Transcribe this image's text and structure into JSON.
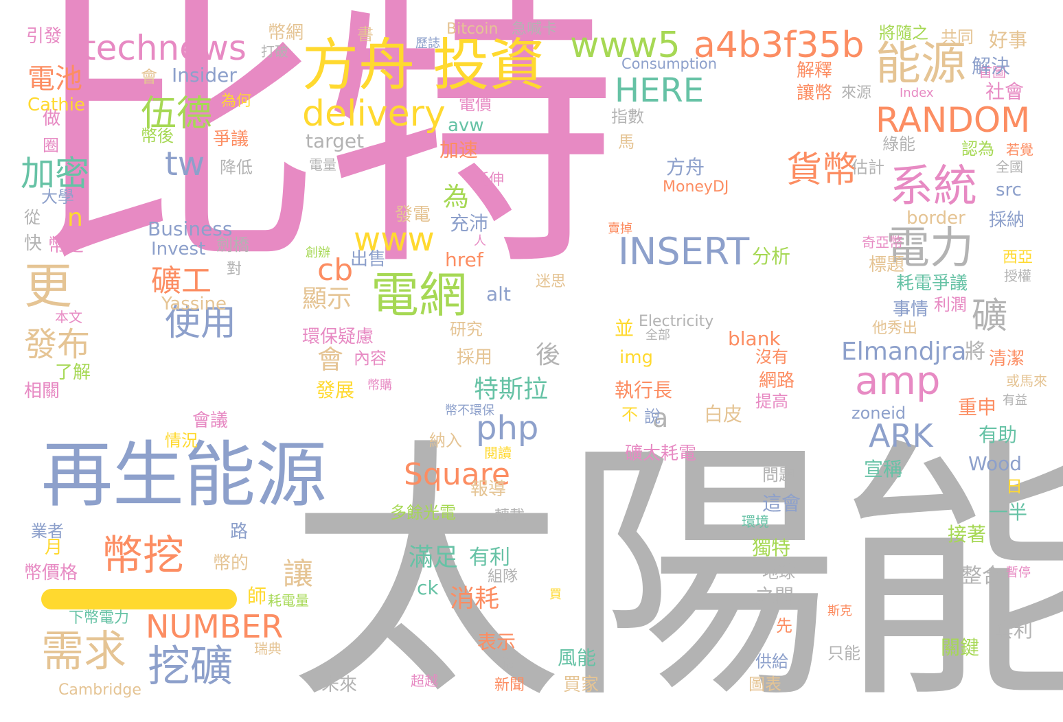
{
  "palette": {
    "pink": "#e78ac3",
    "gray": "#b3b3b3",
    "blue": "#8da0cb",
    "orange": "#fc8d62",
    "green": "#a6d854",
    "yellow": "#ffd92f",
    "teal": "#66c2a5",
    "tan": "#e5c494"
  },
  "words": [
    {
      "text": "比特",
      "color": "pink"
    },
    {
      "text": "太陽能",
      "color": "gray"
    },
    {
      "text": "再生能源",
      "color": "blue"
    },
    {
      "text": "方舟 投資",
      "color": "yellow"
    },
    {
      "text": "technews",
      "color": "pink"
    },
    {
      "text": "www5",
      "color": "green"
    },
    {
      "text": "a4b3f35b",
      "color": "orange"
    },
    {
      "text": "能源",
      "color": "tan"
    },
    {
      "text": "delivery",
      "color": "yellow"
    },
    {
      "text": "HERE",
      "color": "teal"
    },
    {
      "text": "RANDOM",
      "color": "orange"
    },
    {
      "text": "系統",
      "color": "pink"
    },
    {
      "text": "貨幣",
      "color": "orange"
    },
    {
      "text": "電力",
      "color": "gray"
    },
    {
      "text": "伍德",
      "color": "green"
    },
    {
      "text": "tw",
      "color": "blue"
    },
    {
      "text": "加密",
      "color": "teal"
    },
    {
      "text": "電池",
      "color": "orange"
    },
    {
      "text": "為",
      "color": "green"
    },
    {
      "text": "www",
      "color": "yellow"
    },
    {
      "text": "INSERT",
      "color": "blue"
    },
    {
      "text": "cb",
      "color": "orange"
    },
    {
      "text": "電網",
      "color": "green"
    },
    {
      "text": "更",
      "color": "tan"
    },
    {
      "text": "n",
      "color": "yellow"
    },
    {
      "text": "礦工",
      "color": "orange"
    },
    {
      "text": "使用",
      "color": "blue"
    },
    {
      "text": "發布",
      "color": "tan"
    },
    {
      "text": "amp",
      "color": "pink"
    },
    {
      "text": "礦",
      "color": "gray"
    },
    {
      "text": "php",
      "color": "blue"
    },
    {
      "text": "a",
      "color": "gray"
    },
    {
      "text": "ARK",
      "color": "blue"
    },
    {
      "text": "Elmandjra",
      "color": "blue"
    },
    {
      "text": "Square",
      "color": "orange"
    },
    {
      "text": "幣挖",
      "color": "orange"
    },
    {
      "text": "NUMBER",
      "color": "orange"
    },
    {
      "text": "需求",
      "color": "tan"
    },
    {
      "text": "挖礦",
      "color": "blue"
    },
    {
      "text": "會",
      "color": "tan"
    },
    {
      "text": "顯示",
      "color": "tan"
    },
    {
      "text": "特斯拉",
      "color": "teal"
    },
    {
      "text": "後",
      "color": "gray"
    },
    {
      "text": "滿足",
      "color": "teal"
    },
    {
      "text": "消耗",
      "color": "orange"
    },
    {
      "text": "讓",
      "color": "tan"
    },
    {
      "text": "有利",
      "color": "teal"
    },
    {
      "text": "ck",
      "color": "teal"
    },
    {
      "text": "Business",
      "color": "blue"
    },
    {
      "text": "Invest",
      "color": "blue"
    },
    {
      "text": "Insider",
      "color": "blue"
    },
    {
      "text": "Cathie",
      "color": "yellow"
    },
    {
      "text": "Yassine",
      "color": "tan"
    },
    {
      "text": "target",
      "color": "gray"
    },
    {
      "text": "Consumption",
      "color": "blue"
    },
    {
      "text": "Bitcoin",
      "color": "tan"
    },
    {
      "text": "Index",
      "color": "pink"
    },
    {
      "text": "Electricity",
      "color": "gray"
    },
    {
      "text": "MoneyDJ",
      "color": "orange"
    },
    {
      "text": "Cambridge",
      "color": "tan"
    },
    {
      "text": "Wood",
      "color": "blue"
    },
    {
      "text": "blank",
      "color": "orange"
    },
    {
      "text": "zoneid",
      "color": "blue"
    },
    {
      "text": "img",
      "color": "yellow"
    },
    {
      "text": "href",
      "color": "orange"
    },
    {
      "text": "alt",
      "color": "blue"
    },
    {
      "text": "avw",
      "color": "teal"
    },
    {
      "text": "src",
      "color": "blue"
    },
    {
      "text": "border",
      "color": "tan"
    },
    {
      "text": "引發",
      "color": "pink"
    },
    {
      "text": "幣網",
      "color": "tan"
    },
    {
      "text": "打破",
      "color": "gray"
    },
    {
      "text": "書",
      "color": "tan"
    },
    {
      "text": "歷誌",
      "color": "blue"
    },
    {
      "text": "急喊卡",
      "color": "gray"
    },
    {
      "text": "將隨之",
      "color": "green"
    },
    {
      "text": "共同",
      "color": "tan"
    },
    {
      "text": "好事",
      "color": "tan"
    },
    {
      "text": "解釋",
      "color": "orange"
    },
    {
      "text": "首圖",
      "color": "pink"
    },
    {
      "text": "解決",
      "color": "blue"
    },
    {
      "text": "讓幣",
      "color": "orange"
    },
    {
      "text": "來源",
      "color": "gray"
    },
    {
      "text": "社會",
      "color": "pink"
    },
    {
      "text": "會",
      "color": "tan"
    },
    {
      "text": "為何",
      "color": "yellow"
    },
    {
      "text": "做",
      "color": "pink"
    },
    {
      "text": "電價",
      "color": "pink"
    },
    {
      "text": "指數",
      "color": "gray"
    },
    {
      "text": "綠能",
      "color": "gray"
    },
    {
      "text": "認為",
      "color": "green"
    },
    {
      "text": "若覺",
      "color": "orange"
    },
    {
      "text": "圈",
      "color": "pink"
    },
    {
      "text": "幣後",
      "color": "green"
    },
    {
      "text": "爭議",
      "color": "orange"
    },
    {
      "text": "加速",
      "color": "orange"
    },
    {
      "text": "馬",
      "color": "tan"
    },
    {
      "text": "估計",
      "color": "gray"
    },
    {
      "text": "全國",
      "color": "gray"
    },
    {
      "text": "降低",
      "color": "gray"
    },
    {
      "text": "電量",
      "color": "gray"
    },
    {
      "text": "方舟",
      "color": "blue"
    },
    {
      "text": "延伸",
      "color": "pink"
    },
    {
      "text": "大學",
      "color": "blue"
    },
    {
      "text": "從",
      "color": "gray"
    },
    {
      "text": "發電",
      "color": "tan"
    },
    {
      "text": "充沛",
      "color": "blue"
    },
    {
      "text": "採納",
      "color": "blue"
    },
    {
      "text": "快",
      "color": "gray"
    },
    {
      "text": "幣是",
      "color": "pink"
    },
    {
      "text": "劍橋",
      "color": "gray"
    },
    {
      "text": "創辦",
      "color": "green"
    },
    {
      "text": "出售",
      "color": "blue"
    },
    {
      "text": "分析",
      "color": "green"
    },
    {
      "text": "賣掉",
      "color": "orange"
    },
    {
      "text": "人",
      "color": "pink"
    },
    {
      "text": "奇亞幣",
      "color": "pink"
    },
    {
      "text": "西亞",
      "color": "yellow"
    },
    {
      "text": "標題",
      "color": "tan"
    },
    {
      "text": "授權",
      "color": "gray"
    },
    {
      "text": "對",
      "color": "gray"
    },
    {
      "text": "迷思",
      "color": "tan"
    },
    {
      "text": "耗電爭議",
      "color": "teal"
    },
    {
      "text": "利潤",
      "color": "pink"
    },
    {
      "text": "本文",
      "color": "pink"
    },
    {
      "text": "研究",
      "color": "tan"
    },
    {
      "text": "事情",
      "color": "blue"
    },
    {
      "text": "並",
      "color": "yellow"
    },
    {
      "text": "環保疑慮",
      "color": "pink"
    },
    {
      "text": "全部",
      "color": "gray"
    },
    {
      "text": "他秀出",
      "color": "tan"
    },
    {
      "text": "內容",
      "color": "pink"
    },
    {
      "text": "了解",
      "color": "green"
    },
    {
      "text": "沒有",
      "color": "orange"
    },
    {
      "text": "清潔",
      "color": "orange"
    },
    {
      "text": "採用",
      "color": "tan"
    },
    {
      "text": "將",
      "color": "gray"
    },
    {
      "text": "相關",
      "color": "pink"
    },
    {
      "text": "幣購",
      "color": "pink"
    },
    {
      "text": "網路",
      "color": "orange"
    },
    {
      "text": "或馬來",
      "color": "tan"
    },
    {
      "text": "發展",
      "color": "yellow"
    },
    {
      "text": "執行長",
      "color": "orange"
    },
    {
      "text": "提高",
      "color": "pink"
    },
    {
      "text": "有益",
      "color": "gray"
    },
    {
      "text": "說",
      "color": "blue"
    },
    {
      "text": "白皮",
      "color": "tan"
    },
    {
      "text": "幣不環保",
      "color": "blue"
    },
    {
      "text": "不",
      "color": "yellow"
    },
    {
      "text": "重申",
      "color": "orange"
    },
    {
      "text": "會議",
      "color": "pink"
    },
    {
      "text": "納入",
      "color": "tan"
    },
    {
      "text": "有助",
      "color": "teal"
    },
    {
      "text": "情況",
      "color": "yellow"
    },
    {
      "text": "閱讀",
      "color": "yellow"
    },
    {
      "text": "礦太耗電",
      "color": "pink"
    },
    {
      "text": "問題",
      "color": "gray"
    },
    {
      "text": "宣稱",
      "color": "teal"
    },
    {
      "text": "報導",
      "color": "tan"
    },
    {
      "text": "日",
      "color": "yellow"
    },
    {
      "text": "這會",
      "color": "blue"
    },
    {
      "text": "多餘光電",
      "color": "green"
    },
    {
      "text": "轉載",
      "color": "gray"
    },
    {
      "text": "一半",
      "color": "teal"
    },
    {
      "text": "業者",
      "color": "blue"
    },
    {
      "text": "路",
      "color": "blue"
    },
    {
      "text": "環境",
      "color": "teal"
    },
    {
      "text": "月",
      "color": "yellow"
    },
    {
      "text": "獨特",
      "color": "green"
    },
    {
      "text": "接著",
      "color": "green"
    },
    {
      "text": "幣價格",
      "color": "pink"
    },
    {
      "text": "幣的",
      "color": "tan"
    },
    {
      "text": "組隊",
      "color": "gray"
    },
    {
      "text": "地球",
      "color": "gray"
    },
    {
      "text": "整合",
      "color": "gray"
    },
    {
      "text": "暫停",
      "color": "pink"
    },
    {
      "text": "師",
      "color": "yellow"
    },
    {
      "text": "耗電量",
      "color": "green"
    },
    {
      "text": "買",
      "color": "yellow"
    },
    {
      "text": "之間",
      "color": "gray"
    },
    {
      "text": "斯克",
      "color": "orange"
    },
    {
      "text": "下幣電力",
      "color": "teal"
    },
    {
      "text": "先",
      "color": "orange"
    },
    {
      "text": "瑞典",
      "color": "tan"
    },
    {
      "text": "表示",
      "color": "orange"
    },
    {
      "text": "商",
      "color": "gray"
    },
    {
      "text": "風能",
      "color": "teal"
    },
    {
      "text": "關鍵",
      "color": "green"
    },
    {
      "text": "套利",
      "color": "gray"
    },
    {
      "text": "供給",
      "color": "blue"
    },
    {
      "text": "只能",
      "color": "gray"
    },
    {
      "text": "未來",
      "color": "gray"
    },
    {
      "text": "超越",
      "color": "pink"
    },
    {
      "text": "新聞",
      "color": "orange"
    },
    {
      "text": "買家",
      "color": "tan"
    },
    {
      "text": "圖表",
      "color": "tan"
    }
  ]
}
